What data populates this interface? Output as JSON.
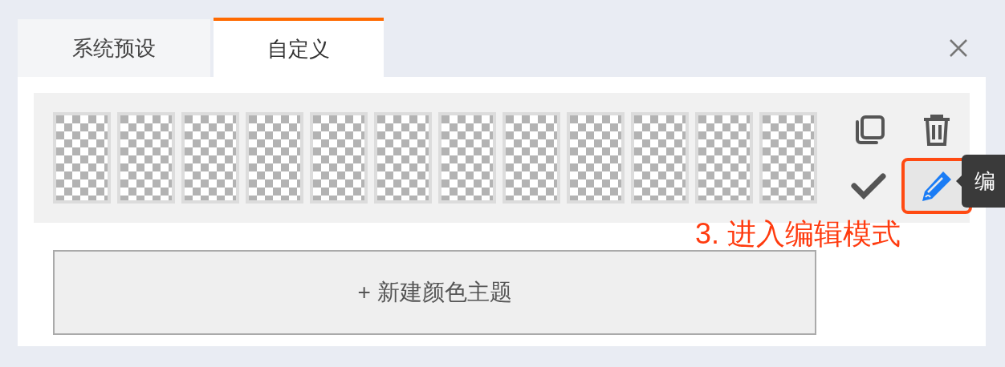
{
  "tabs": [
    {
      "label": "系统预设",
      "selected": false
    },
    {
      "label": "自定义",
      "selected": true
    }
  ],
  "swatches": [
    {
      "kind": "transparent"
    },
    {
      "kind": "transparent"
    },
    {
      "kind": "transparent"
    },
    {
      "kind": "transparent"
    },
    {
      "kind": "transparent"
    },
    {
      "kind": "transparent"
    },
    {
      "kind": "transparent"
    },
    {
      "kind": "transparent"
    },
    {
      "kind": "transparent"
    },
    {
      "kind": "transparent"
    },
    {
      "kind": "transparent"
    },
    {
      "kind": "transparent"
    }
  ],
  "actions": [
    {
      "kind": "copy",
      "highlighted": false
    },
    {
      "kind": "delete",
      "highlighted": false
    },
    {
      "kind": "confirm",
      "highlighted": false
    },
    {
      "kind": "edit",
      "highlighted": true
    }
  ],
  "tooltip": "编",
  "annotation": "3. 进入编辑模式",
  "new_button": "+ 新建颜色主题"
}
